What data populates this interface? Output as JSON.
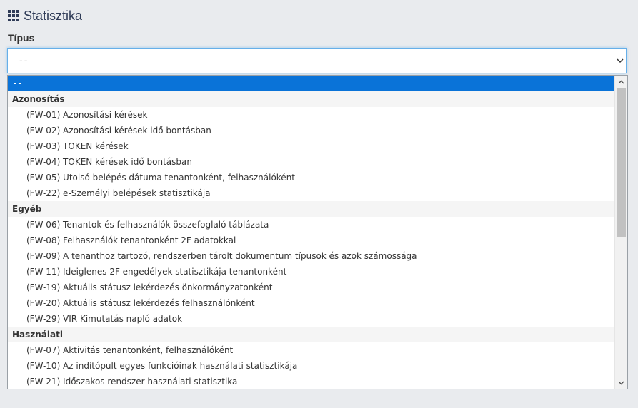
{
  "header": {
    "title": "Statisztika",
    "icon": "grid-icon"
  },
  "form": {
    "type_label": "Típus",
    "select_value": "--"
  },
  "listbox": {
    "selected_option": "--",
    "groups": [
      {
        "label": "Azonosítás",
        "options": [
          "(FW-01) Azonosítási kérések",
          "(FW-02) Azonosítási kérések idő bontásban",
          "(FW-03) TOKEN kérések",
          "(FW-04) TOKEN kérések idő bontásban",
          "(FW-05) Utolsó belépés dátuma tenantonként, felhasználóként",
          "(FW-22) e-Személyi belépések statisztikája"
        ]
      },
      {
        "label": "Egyéb",
        "options": [
          "(FW-06) Tenantok és felhasználók összefoglaló táblázata",
          "(FW-08) Felhasználók tenantonként 2F adatokkal",
          "(FW-09) A tenanthoz tartozó, rendszerben tárolt dokumentum típusok és azok számossága",
          "(FW-11) Ideiglenes 2F engedélyek statisztikája tenantonként",
          "(FW-19) Aktuális státusz lekérdezés önkormányzatonként",
          "(FW-20) Aktuális státusz lekérdezés felhasználónként",
          "(FW-29) VIR Kimutatás napló adatok"
        ]
      },
      {
        "label": "Használati",
        "options": [
          "(FW-07) Aktivitás tenantonként, felhasználóként",
          "(FW-10) Az indítópult egyes funkcióinak használati statisztikája",
          "(FW-21) Időszakos rendszer használati statisztika"
        ]
      }
    ]
  },
  "colors": {
    "selected_bg": "#0a73d8",
    "title": "#2f3b57",
    "focus_border": "#66afe9"
  }
}
